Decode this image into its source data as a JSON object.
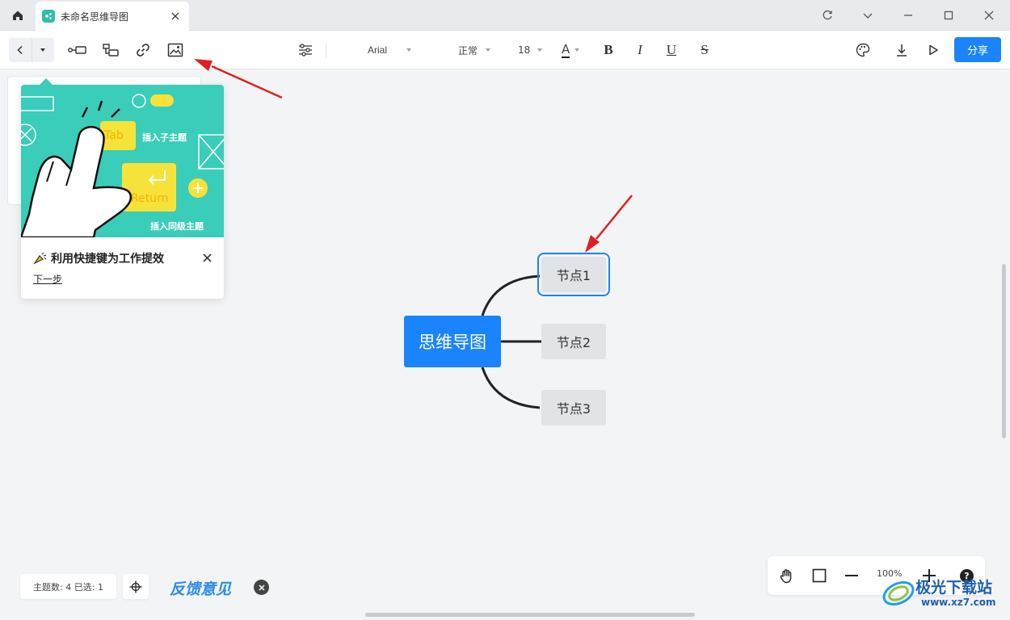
{
  "window": {
    "tab_title": "未命名思维导图"
  },
  "toolbar": {
    "font_family": "Arial",
    "font_weight": "正常",
    "font_size": "18",
    "font_color_label": "A",
    "bold_label": "B",
    "italic_label": "I",
    "underline_label": "U",
    "strike_label": "S",
    "share_label": "分享"
  },
  "mindmap": {
    "root": "思维导图",
    "children": [
      "节点1",
      "节点2",
      "节点3"
    ],
    "selected_index": 0
  },
  "tip": {
    "title": "利用快捷键为工作提效",
    "next": "下一步",
    "illustration": {
      "key_tab": "Tab",
      "key_tab_hint": "插入子主题",
      "key_return": "Return",
      "key_return_hint": "插入同级主题"
    }
  },
  "status": {
    "text": "主题数: 4 已选: 1"
  },
  "feedback": {
    "label": "反馈意见"
  },
  "zoom": {
    "level": "100%",
    "help": "?"
  },
  "watermark": {
    "text": "极光下载站",
    "url": "www.xz7.com"
  },
  "colors": {
    "accent": "#1a84ff",
    "tip_green": "#3acdb9",
    "arrow_red": "#e02020"
  }
}
